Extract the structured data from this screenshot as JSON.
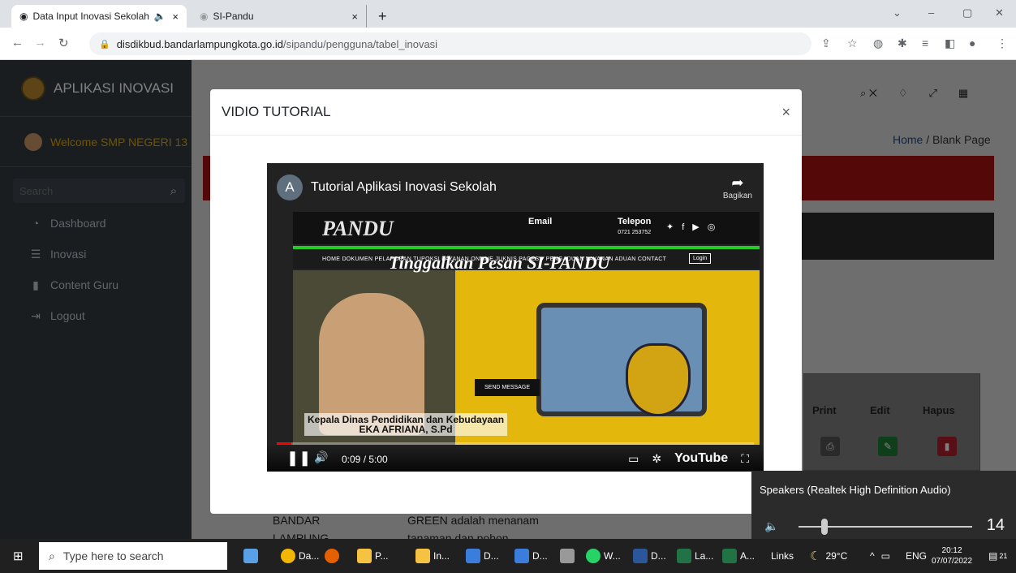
{
  "browser": {
    "tabs": [
      {
        "title": "Data Input Inovasi Sekolah",
        "audio_icon": "🔈",
        "close": "×"
      },
      {
        "title": "SI-Pandu",
        "close": "×"
      }
    ],
    "new_tab": "+",
    "url_host": "disdikbud.bandarlampungkota.go.id",
    "url_path": "/sipandu/pengguna/tabel_inovasi"
  },
  "sidebar": {
    "brand": "APLIKASI INOVASI",
    "welcome": "Welcome SMP NEGERI 13",
    "search_placeholder": "Search",
    "items": [
      {
        "label": "Dashboard",
        "icon": "tachometer-icon"
      },
      {
        "label": "Inovasi",
        "icon": "database-icon"
      },
      {
        "label": "Content Guru",
        "icon": "file-icon"
      },
      {
        "label": "Logout",
        "icon": "sign-out-icon"
      }
    ]
  },
  "page": {
    "breadcrumb_home": "Home",
    "breadcrumb_sep": "/",
    "breadcrumb_current": "Blank Page",
    "table_headers": {
      "print": "Print",
      "edit": "Edit",
      "hapus": "Hapus"
    },
    "row_text_left": [
      "BANDAR",
      "LAMPUNG"
    ],
    "row_text_mid": [
      "GREEN adalah menanam",
      "tanaman dan pohon."
    ]
  },
  "modal": {
    "title": "VIDIO TUTORIAL",
    "close": "×",
    "video": {
      "channel_initial": "A",
      "title": "Tutorial Aplikasi Inovasi Sekolah",
      "share_label": "Bagikan",
      "site_logo": "PANDU",
      "site_email_label": "Email",
      "site_phone_label": "Telepon",
      "site_phone": "0721 253752",
      "site_menu": "HOME   DOKUMEN PELAPORAN   TUPOKSI   LAYANAN ONLINE   JUKNIS   PAGES ▾   PENGADUAN   LAYANAN   ADUAN   CONTACT",
      "site_login": "Login",
      "tagline": "Tinggalkan Pesan SI-PANDU",
      "send_message": "SEND MESSAGE",
      "caption_line1": "Kepala Dinas Pendidikan dan Kebudayaan",
      "caption_line2": "EKA AFRIANA, S.Pd",
      "time": "0:09 / 5:00",
      "progress_fraction": 0.03,
      "youtube_label": "YouTube"
    }
  },
  "volume": {
    "device": "Speakers (Realtek High Definition Audio)",
    "level": "14"
  },
  "taskbar": {
    "search_placeholder": "Type here to search",
    "apps": [
      "Da...",
      "P...",
      "In...",
      "D...",
      "D...",
      "W...",
      "D...",
      "La...",
      "A..."
    ],
    "links": "Links",
    "temp": "29°C",
    "lang": "ENG",
    "time": "20:12",
    "date": "07/07/2022",
    "notif": "21"
  }
}
